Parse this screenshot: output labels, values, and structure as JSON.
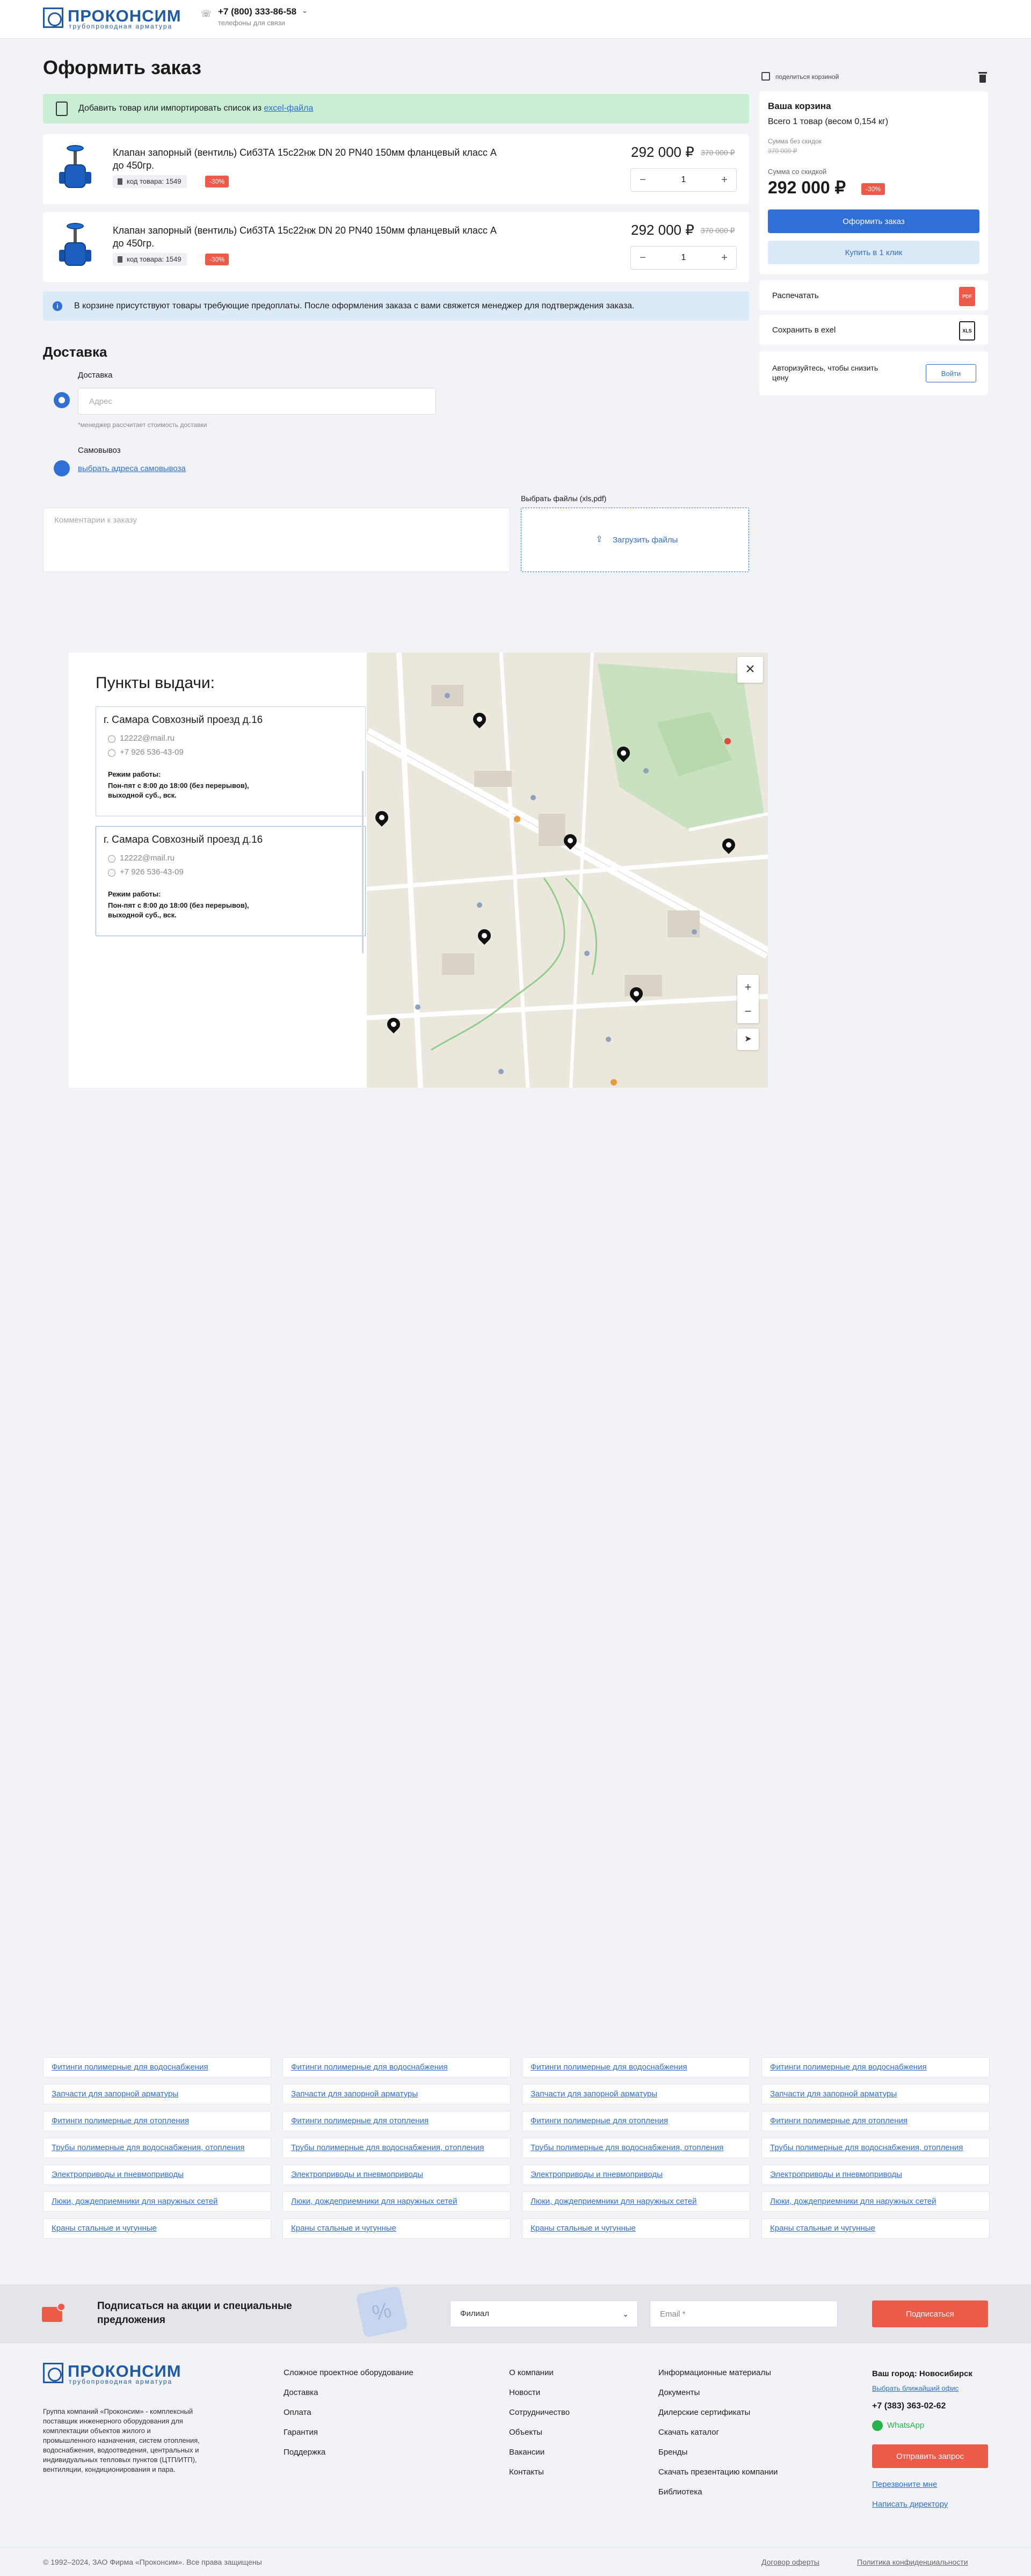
{
  "header": {
    "logo_name": "ПРОКОНСИМ",
    "logo_sub": "трубопроводная арматура",
    "phone": "+7 (800) 333-86-58",
    "phone_sub": "телефоны для связи"
  },
  "page_title": "Оформить заказ",
  "import_banner": {
    "text": "Добавить товар или импортировать список из",
    "link": "excel-файла"
  },
  "products": [
    {
      "name": "Клапан запорный (вентиль) Сиб3ТА 15с22нж DN 20 PN40 150мм фланцевый класс А до 450гр.",
      "code": "код товара: 1549",
      "discount": "-30%",
      "price": "292 000 ₽",
      "old_price": "370 000 ₽",
      "qty": "1"
    },
    {
      "name": "Клапан запорный (вентиль) Сиб3ТА 15с22нж DN 20 PN40 150мм фланцевый класс А до 450гр.",
      "code": "код товара: 1549",
      "discount": "-30%",
      "price": "292 000 ₽",
      "old_price": "370 000 ₽",
      "qty": "1"
    }
  ],
  "info_banner": "В корзине присутствуют товары требующие предоплаты. После оформления заказа с вами свяжется менеджер для подтверждения заказа.",
  "delivery": {
    "title": "Доставка",
    "option1_label": "Доставка",
    "address_placeholder": "Адрес",
    "note": "*менеджер рассчитает стоимость доставки",
    "option2_label": "Самовывоз",
    "pickup_link": "выбрать адреса самовывоза",
    "comment_placeholder": "Комментарии к заказу",
    "files_label": "Выбрать файлы (xls,pdf)",
    "upload_label": "Загрузить файлы"
  },
  "sidebar": {
    "share": "поделиться корзиной",
    "cart_title": "Ваша корзина",
    "cart_count": "Всего 1 товар (весом 0,154 кг)",
    "sum_no_disc_label": "Сумма без скидок",
    "sum_no_disc": "370 000 ₽",
    "sum_disc_label": "Сумма со скидкой",
    "sum_disc": "292 000 ₽",
    "discount": "-30%",
    "order_btn": "Оформить заказ",
    "oneclick_btn": "Купить в 1 клик",
    "print": "Распечатать",
    "pdf": "PDF",
    "save_excel": "Сохранить в exel",
    "xls": "XLS",
    "auth_text": "Авторизуйтесь, чтобы снизить цену",
    "login_btn": "Войти"
  },
  "pickup_modal": {
    "title": "Пункты выдачи:",
    "close": "×",
    "points": [
      {
        "address": "г. Самара Совхозный проезд д.16",
        "email": "12222@mail.ru",
        "phone": "+7 926 536-43-09",
        "mode_title": "Режим работы:",
        "mode": "Пон-пят с 8:00 до 18:00 (без перерывов), выходной суб., вск."
      },
      {
        "address": "г. Самара Совхозный проезд д.16",
        "email": "12222@mail.ru",
        "phone": "+7 926 536-43-09",
        "mode_title": "Режим работы:",
        "mode": "Пон-пят с 8:00 до 18:00 (без перерывов), выходной суб., вск."
      }
    ],
    "zoom_in": "+",
    "zoom_out": "−"
  },
  "categories": [
    [
      "Фитинги полимерные для водоснабжения",
      "Запчасти для запорной арматуры",
      "Фитинги полимерные для отопления",
      "Трубы полимерные для водоснабжения, отопления",
      "Электроприводы и пневмоприводы",
      "Люки, дождеприемники для наружных сетей",
      "Краны стальные и чугунные"
    ],
    [
      "Фитинги полимерные для водоснабжения",
      "Запчасти для запорной арматуры",
      "Фитинги полимерные для отопления",
      "Трубы полимерные для водоснабжения, отопления",
      "Электроприводы и пневмоприводы",
      "Люки, дождеприемники для наружных сетей",
      "Краны стальные и чугунные"
    ],
    [
      "Фитинги полимерные для водоснабжения",
      "Запчасти для запорной арматуры",
      "Фитинги полимерные для отопления",
      "Трубы полимерные для водоснабжения, отопления",
      "Электроприводы и пневмоприводы",
      "Люки, дождеприемники для наружных сетей",
      "Краны стальные и чугунные"
    ],
    [
      "Фитинги полимерные для водоснабжения",
      "Запчасти для запорной арматуры",
      "Фитинги полимерные для отопления",
      "Трубы полимерные для водоснабжения, отопления",
      "Электроприводы и пневмоприводы",
      "Люки, дождеприемники для наружных сетей",
      "Краны стальные и чугунные"
    ]
  ],
  "subscribe": {
    "title": "Подписаться на акции и специальные предложения",
    "branch": "Филиал",
    "email_placeholder": "Email *",
    "btn": "Подписаться"
  },
  "footer": {
    "about": "Группа компаний «Проконсим» - комплексный поставщик инженерного оборудования для комплектации объектов жилого и промышленного назначения, систем отопления, водоснабжения, водоотведения, центральных и индивидуальных тепловых пунктов (ЦТП/ИТП), вентиляции, кондиционирования и пара.",
    "col1": [
      "Сложное проектное оборудование",
      "Доставка",
      "Оплата",
      "Гарантия",
      "Поддержка"
    ],
    "col2": [
      "О компании",
      "Новости",
      "Сотрудничество",
      "Объекты",
      "Вакансии",
      "Контакты"
    ],
    "col3": [
      "Информационные материалы",
      "Документы",
      "Дилерские сертификаты",
      "Скачать каталог",
      "Бренды",
      "Скачать презентацию компании",
      "Библиотека"
    ],
    "city": "Ваш город: Новосибирск",
    "city_link": "Выбрать ближайший офис",
    "phone": "+7 (383) 363-02-62",
    "whatsapp": "WhatsApp",
    "request_btn": "Отправить запрос",
    "callback": "Перезвоните мне",
    "director": "Написать директору",
    "copyright": "© 1992–2024, ЗАО Фирма «Проконсим». Все права защищены",
    "offer": "Договор оферты",
    "privacy": "Политика конфиденциальности"
  }
}
